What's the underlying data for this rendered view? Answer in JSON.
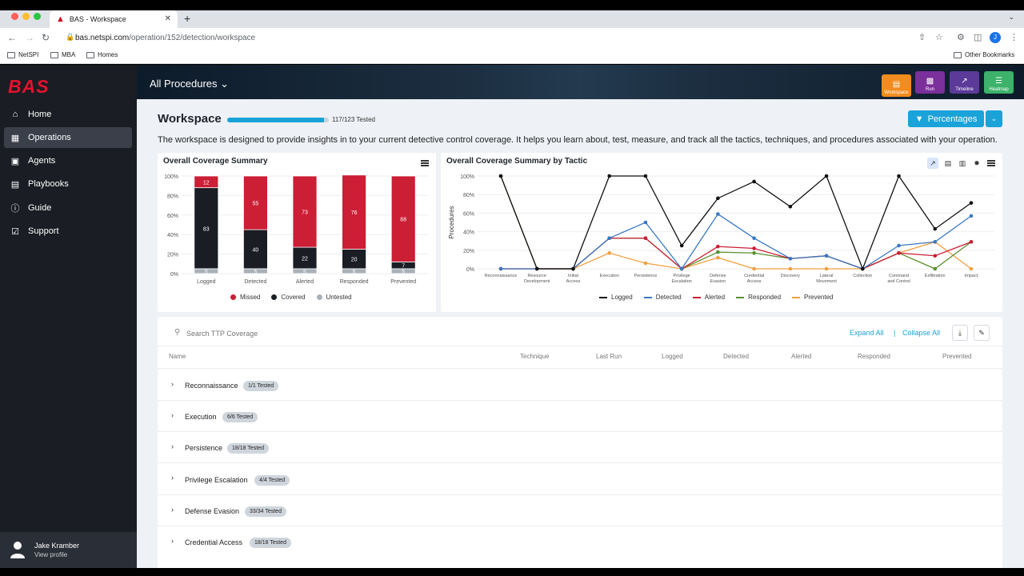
{
  "browser": {
    "tab_title": "BAS - Workspace",
    "url_host": "bas.netspi.com",
    "url_path": "/operation/152/detection/workspace",
    "avatar_letter": "J",
    "bookmarks": [
      "NetSPI",
      "MBA",
      "Homes"
    ],
    "other_bookmarks": "Other Bookmarks"
  },
  "sidebar": {
    "logo": "BAS",
    "items": [
      {
        "label": "Home",
        "icon": "home-icon"
      },
      {
        "label": "Operations",
        "icon": "columns-icon"
      },
      {
        "label": "Agents",
        "icon": "monitor-icon"
      },
      {
        "label": "Playbooks",
        "icon": "book-icon"
      },
      {
        "label": "Guide",
        "icon": "info-icon"
      },
      {
        "label": "Support",
        "icon": "support-icon"
      }
    ],
    "profile_name": "Jake Kramber",
    "profile_link": "View profile"
  },
  "header": {
    "procedures": "All Procedures",
    "tiles": [
      {
        "label": "Workspace",
        "color": "#f28c1e"
      },
      {
        "label": "Run",
        "color": "#7b2f9b"
      },
      {
        "label": "Timeline",
        "color": "#5b3a99"
      },
      {
        "label": "Heatmap",
        "color": "#3cb26a"
      }
    ]
  },
  "workspace": {
    "title": "Workspace",
    "progress_fraction": 0.951,
    "tested_label": "117/123 Tested",
    "description": "The workspace is designed to provide insights in to your current detective control coverage. It helps you learn about, test, measure, and track all the tactics, techniques, and procedures associated with your operation.",
    "percentages_button": "Percentages"
  },
  "colors": {
    "missed": "#cc1e35",
    "covered": "#1a1d23",
    "untested": "#a9b0b8",
    "accent": "#1aa3d9"
  },
  "chart_data": [
    {
      "type": "bar",
      "title": "Overall Coverage Summary",
      "stacked": true,
      "categories": [
        "Logged",
        "Detected",
        "Alerted",
        "Responded",
        "Prevented"
      ],
      "series": [
        {
          "name": "Untested",
          "values": [
            5,
            5,
            5,
            5,
            5
          ]
        },
        {
          "name": "Covered",
          "values": [
            83,
            40,
            22,
            20,
            7
          ]
        },
        {
          "name": "Missed",
          "values": [
            12,
            55,
            73,
            76,
            88
          ]
        }
      ],
      "ylim": [
        0,
        100
      ],
      "yticks": [
        "0%",
        "20%",
        "40%",
        "60%",
        "80%",
        "100%"
      ],
      "legend": "bottom"
    },
    {
      "type": "line",
      "title": "Overall Coverage Summary by Tactic",
      "ylabel": "Procedures",
      "categories": [
        "Reconnaissance",
        "Resource Development",
        "Initial Access",
        "Execution",
        "Persistence",
        "Privilege Escalation",
        "Defense Evasion",
        "Credential Access",
        "Discovery",
        "Lateral Movement",
        "Collection",
        "Command and Control",
        "Exfiltration",
        "Impact"
      ],
      "series": [
        {
          "name": "Logged",
          "color": "#111111",
          "values": [
            100,
            0,
            0,
            100,
            100,
            25,
            76,
            94,
            67,
            100,
            0,
            100,
            43,
            71
          ]
        },
        {
          "name": "Detected",
          "color": "#3b78c2",
          "values": [
            0,
            0,
            0,
            33,
            50,
            0,
            59,
            33,
            11,
            14,
            0,
            25,
            29,
            57
          ]
        },
        {
          "name": "Alerted",
          "color": "#cc1e35",
          "values": [
            0,
            0,
            0,
            33,
            33,
            0,
            24,
            22,
            11,
            14,
            0,
            17,
            14,
            29
          ]
        },
        {
          "name": "Responded",
          "color": "#5a8f2e",
          "values": [
            100,
            0,
            0,
            33,
            33,
            0,
            18,
            17,
            11,
            14,
            0,
            17,
            0,
            29
          ]
        },
        {
          "name": "Prevented",
          "color": "#f0a040",
          "values": [
            0,
            0,
            0,
            17,
            6,
            0,
            12,
            0,
            0,
            0,
            0,
            17,
            29,
            0
          ]
        }
      ],
      "ylim": [
        0,
        100
      ],
      "yticks": [
        "0%",
        "20%",
        "40%",
        "60%",
        "80%",
        "100%"
      ],
      "legend": "bottom"
    }
  ],
  "table": {
    "search_placeholder": "Search TTP Coverage",
    "expand_all": "Expand All",
    "collapse_all": "Collapse All",
    "separator": "|",
    "columns": [
      "Name",
      "Technique",
      "Last Run",
      "Logged",
      "Detected",
      "Alerted",
      "Responded",
      "Prevented"
    ],
    "rows": [
      {
        "name": "Reconnaissance",
        "badge": "1/1 Tested"
      },
      {
        "name": "Execution",
        "badge": "6/6 Tested"
      },
      {
        "name": "Persistence",
        "badge": "18/18 Tested"
      },
      {
        "name": "Privilege Escalation",
        "badge": "4/4 Tested"
      },
      {
        "name": "Defense Evasion",
        "badge": "33/34 Tested"
      },
      {
        "name": "Credential Access",
        "badge": "18/18 Tested"
      }
    ]
  }
}
